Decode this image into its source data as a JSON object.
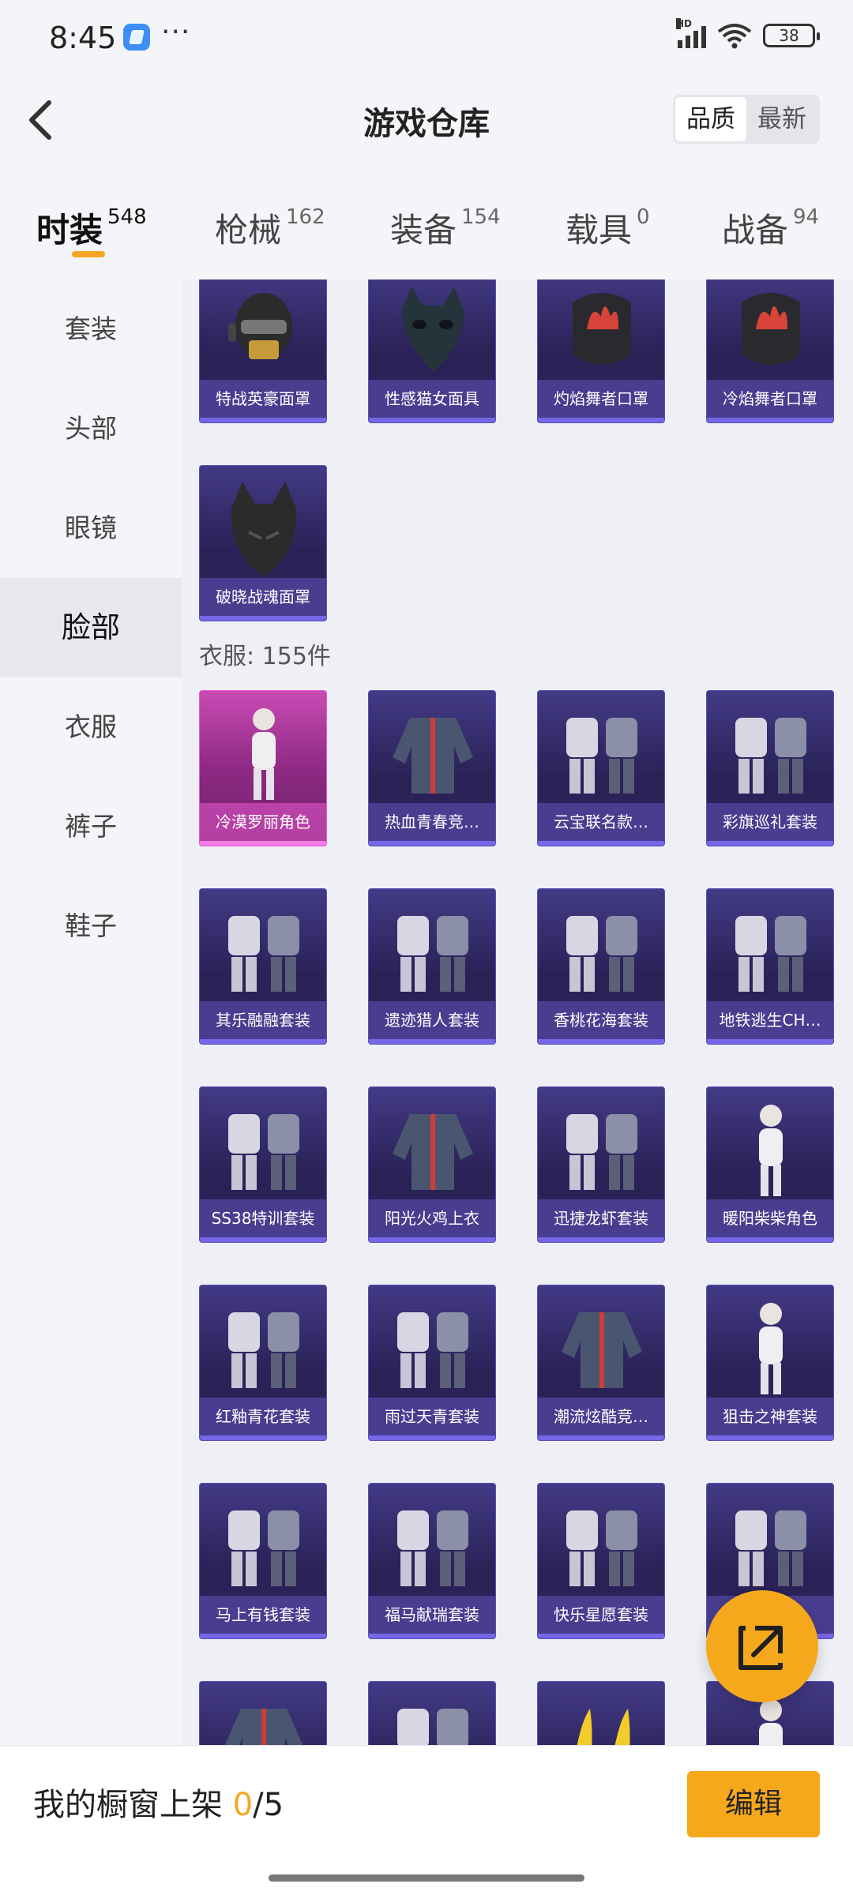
{
  "status_bar": {
    "time": "8:45",
    "dots": "···",
    "battery": "38"
  },
  "header": {
    "title": "游戏仓库",
    "sort_options": [
      "品质",
      "最新"
    ],
    "active_sort": 0
  },
  "tabs": [
    {
      "label": "时装",
      "count": "548",
      "active": true
    },
    {
      "label": "枪械",
      "count": "162"
    },
    {
      "label": "装备",
      "count": "154"
    },
    {
      "label": "载具",
      "count": "0"
    },
    {
      "label": "战备",
      "count": "94"
    }
  ],
  "sidebar": {
    "items": [
      "套装",
      "头部",
      "眼镜",
      "脸部",
      "衣服",
      "裤子",
      "鞋子"
    ],
    "active_index": 3
  },
  "face_section": {
    "items": [
      {
        "name": "特战英豪面罩",
        "icon": "mask-icon"
      },
      {
        "name": "性感猫女面具",
        "icon": "cat-mask-icon"
      },
      {
        "name": "灼焰舞者口罩",
        "icon": "flame-mask-icon"
      },
      {
        "name": "冷焰舞者口罩",
        "icon": "flame-mask-icon"
      },
      {
        "name": "破晓战魂面罩",
        "icon": "wolf-mask-icon"
      }
    ]
  },
  "clothes_section": {
    "title": "衣服: 155件",
    "items": [
      {
        "name": "冷漠罗丽角色",
        "rarity": "legendary",
        "icon": "character-icon"
      },
      {
        "name": "热血青春竞…",
        "icon": "jacket-icon"
      },
      {
        "name": "云宝联名款…",
        "icon": "outfit-icon"
      },
      {
        "name": "彩旗巡礼套装",
        "icon": "outfit-icon"
      },
      {
        "name": "其乐融融套装",
        "icon": "outfit-icon"
      },
      {
        "name": "遗迹猎人套装",
        "icon": "outfit-icon"
      },
      {
        "name": "香桃花海套装",
        "icon": "outfit-icon"
      },
      {
        "name": "地铁逃生CH…",
        "icon": "outfit-icon"
      },
      {
        "name": "SS38特训套装",
        "icon": "outfit-icon"
      },
      {
        "name": "阳光火鸡上衣",
        "icon": "jacket-icon"
      },
      {
        "name": "迅捷龙虾套装",
        "icon": "outfit-icon"
      },
      {
        "name": "暖阳柴柴角色",
        "icon": "character-icon"
      },
      {
        "name": "红釉青花套装",
        "icon": "outfit-icon"
      },
      {
        "name": "雨过天青套装",
        "icon": "outfit-icon"
      },
      {
        "name": "潮流炫酷竞…",
        "icon": "jacket-icon"
      },
      {
        "name": "狙击之神套装",
        "icon": "character-icon"
      },
      {
        "name": "马上有钱套装",
        "icon": "outfit-icon"
      },
      {
        "name": "福马献瑞套装",
        "icon": "outfit-icon"
      },
      {
        "name": "快乐星愿套装",
        "icon": "outfit-icon"
      },
      {
        "name": "",
        "icon": "outfit-icon"
      },
      {
        "name": "",
        "icon": "jacket-icon"
      },
      {
        "name": "",
        "icon": "outfit-icon"
      },
      {
        "name": "",
        "icon": "banana-icon"
      },
      {
        "name": "",
        "icon": "character-icon"
      }
    ]
  },
  "bottom_bar": {
    "label": "我的橱窗上架 ",
    "used": "0",
    "total": "/5",
    "edit_label": "编辑"
  },
  "colors": {
    "accent": "#f6a81c",
    "card_purple": "#2c2358",
    "card_pink": "#c94bb4"
  }
}
